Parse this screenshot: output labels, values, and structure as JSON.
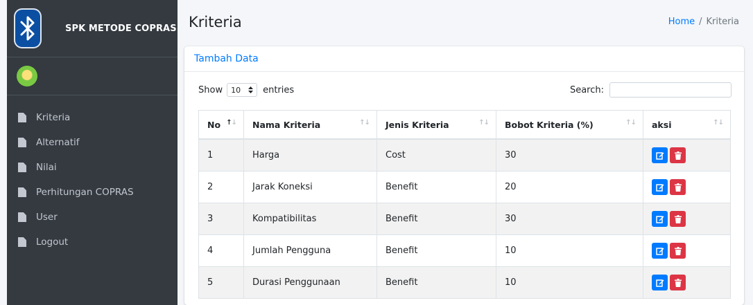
{
  "brand": {
    "title": "SPK METODE COPRAS"
  },
  "sidebar": {
    "items": [
      {
        "label": "Kriteria"
      },
      {
        "label": "Alternatif"
      },
      {
        "label": "Nilai"
      },
      {
        "label": "Perhitungan COPRAS"
      },
      {
        "label": "User"
      },
      {
        "label": "Logout"
      }
    ]
  },
  "header": {
    "title": "Kriteria",
    "breadcrumb": {
      "home": "Home",
      "separator": "/",
      "current": "Kriteria"
    }
  },
  "card": {
    "add_link": "Tambah Data"
  },
  "controls": {
    "show_label": "Show",
    "entries_value": "10",
    "entries_label": "entries",
    "search_label": "Search:",
    "search_value": ""
  },
  "table": {
    "columns": [
      "No",
      "Nama Kriteria",
      "Jenis Kriteria",
      "Bobot Kriteria (%)",
      "aksi"
    ],
    "rows": [
      {
        "no": "1",
        "nama": "Harga",
        "jenis": "Cost",
        "bobot": "30"
      },
      {
        "no": "2",
        "nama": "Jarak Koneksi",
        "jenis": "Benefit",
        "bobot": "20"
      },
      {
        "no": "3",
        "nama": "Kompatibilitas",
        "jenis": "Benefit",
        "bobot": "30"
      },
      {
        "no": "4",
        "nama": "Jumlah Pengguna",
        "jenis": "Benefit",
        "bobot": "10"
      },
      {
        "no": "5",
        "nama": "Durasi Penggunaan",
        "jenis": "Benefit",
        "bobot": "10"
      }
    ]
  },
  "colors": {
    "sidebar_bg": "#343a40",
    "primary": "#007bff",
    "danger": "#dc3545",
    "brand_logo": "#0b4fa3"
  },
  "icons": {
    "brand": "bluetooth-icon",
    "user": "user-avatar",
    "nav": "file-icon",
    "edit": "edit-icon",
    "delete": "trash-icon"
  }
}
